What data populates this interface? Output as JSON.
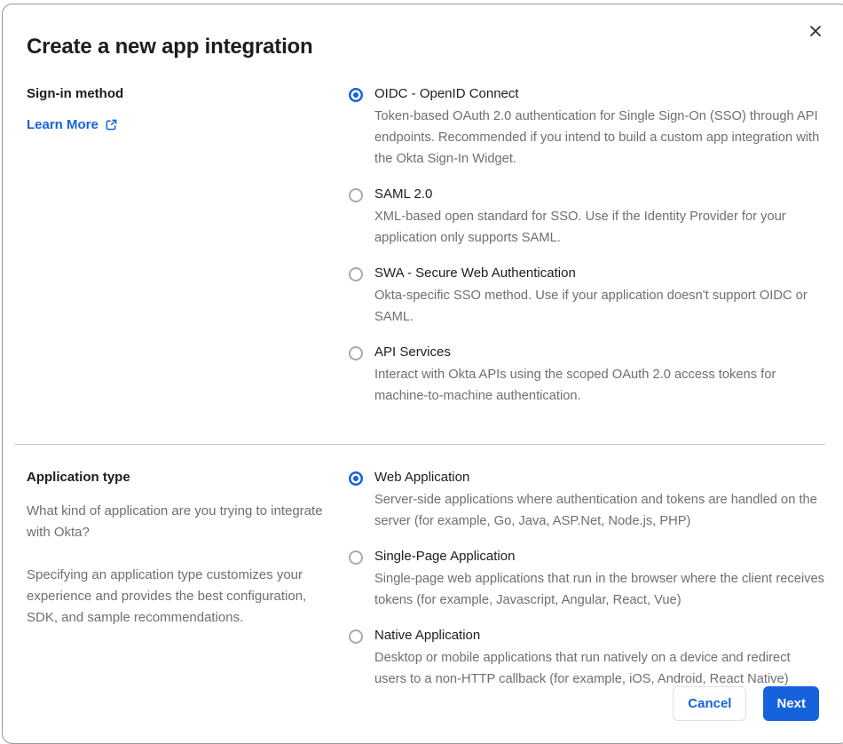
{
  "modal": {
    "title": "Create a new app integration"
  },
  "signin_section": {
    "label": "Sign-in method",
    "learn_more_label": "Learn More",
    "options": [
      {
        "label": "OIDC - OpenID Connect",
        "description": "Token-based OAuth 2.0 authentication for Single Sign-On (SSO) through API endpoints. Recommended if you intend to build a custom app integration with the Okta Sign-In Widget.",
        "selected": true
      },
      {
        "label": "SAML 2.0",
        "description": "XML-based open standard for SSO. Use if the Identity Provider for your application only supports SAML.",
        "selected": false
      },
      {
        "label": "SWA - Secure Web Authentication",
        "description": "Okta-specific SSO method. Use if your application doesn't support OIDC or SAML.",
        "selected": false
      },
      {
        "label": "API Services",
        "description": "Interact with Okta APIs using the scoped OAuth 2.0 access tokens for machine-to-machine authentication.",
        "selected": false
      }
    ]
  },
  "apptype_section": {
    "label": "Application type",
    "intro_1": "What kind of application are you trying to integrate with Okta?",
    "intro_2": "Specifying an application type customizes your experience and provides the best configuration, SDK, and sample recommendations.",
    "options": [
      {
        "label": "Web Application",
        "description": "Server-side applications where authentication and tokens are handled on the server (for example, Go, Java, ASP.Net, Node.js, PHP)",
        "selected": true
      },
      {
        "label": "Single-Page Application",
        "description": "Single-page web applications that run in the browser where the client receives tokens (for example, Javascript, Angular, React, Vue)",
        "selected": false
      },
      {
        "label": "Native Application",
        "description": "Desktop or mobile applications that run natively on a device and redirect users to a non-HTTP callback (for example, iOS, Android, React Native)",
        "selected": false
      }
    ]
  },
  "footer": {
    "cancel_label": "Cancel",
    "next_label": "Next"
  },
  "colors": {
    "accent_blue": "#1662dd",
    "text_dark": "#1d1d21",
    "text_gray": "#6e6e78",
    "divider": "#c9c9cf"
  }
}
